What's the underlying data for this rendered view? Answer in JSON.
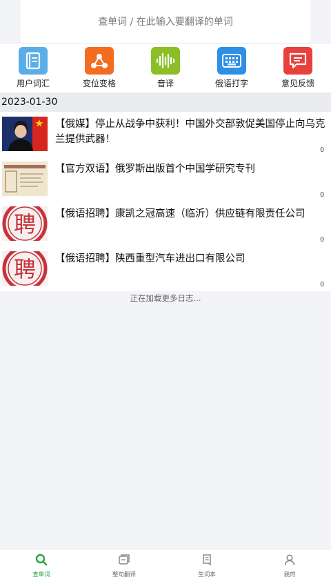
{
  "search": {
    "placeholder": "查单词 / 在此输入要翻译的单词"
  },
  "tools": [
    {
      "label": "用户词汇",
      "icon": "notebook-icon",
      "color": "#5aaee8"
    },
    {
      "label": "变位变格",
      "icon": "share-nodes-icon",
      "color": "#f36d21"
    },
    {
      "label": "音译",
      "icon": "sound-wave-icon",
      "color": "#8cbf27"
    },
    {
      "label": "俄语打字",
      "icon": "keyboard-icon",
      "color": "#2d8fe6"
    },
    {
      "label": "意见反馈",
      "icon": "feedback-chat-icon",
      "color": "#e8403a"
    }
  ],
  "date": "2023-01-30",
  "news": [
    {
      "title": "【俄媒】停止从战争中获利！中国外交部敦促美国停止向乌克兰提供武器！",
      "count": "0",
      "thumb": "spokesperson-photo"
    },
    {
      "title": "【官方双语】俄罗斯出版首个中国学研究专刊",
      "count": "0",
      "thumb": "journal-cover"
    },
    {
      "title": "【俄语招聘】康凯之冠高速（临沂）供应链有限责任公司",
      "count": "0",
      "thumb": "hiring-stamp",
      "stamp_text": "聘"
    },
    {
      "title": "【俄语招聘】陕西重型汽车进出口有限公司",
      "count": "0",
      "thumb": "hiring-stamp",
      "stamp_text": "聘"
    }
  ],
  "loading_text": "正在加载更多日志...",
  "bottom_nav": [
    {
      "label": "查单词",
      "icon": "search-icon",
      "active": true
    },
    {
      "label": "整句翻译",
      "icon": "translate-icon",
      "active": false
    },
    {
      "label": "生词本",
      "icon": "wordbook-icon",
      "active": false
    },
    {
      "label": "我的",
      "icon": "user-icon",
      "active": false
    }
  ],
  "colors": {
    "accent": "#21a83c"
  }
}
